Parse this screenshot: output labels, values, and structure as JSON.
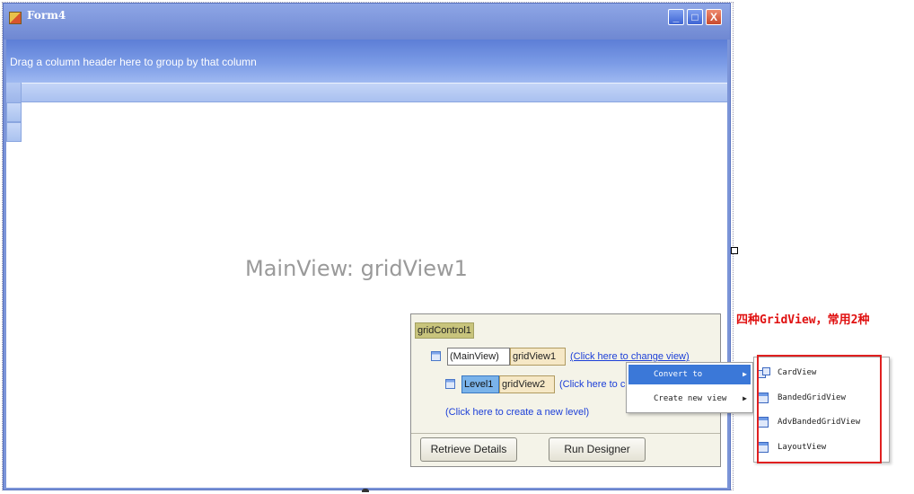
{
  "window": {
    "title": "Form4",
    "group_panel_text": "Drag a column header here to group by that column",
    "main_view_label": "MainView: gridView1"
  },
  "designer": {
    "control_name": "gridControl1",
    "main_view_tag": "(MainView)",
    "main_view_name": "gridView1",
    "change_view_link": "(Click here to change view)",
    "level_tag": "Level1",
    "level_view_name": "gridView2",
    "level_change_link": "(Click here to change view)",
    "new_level_link": "(Click here to create a new level)",
    "retrieve_button": "Retrieve Details",
    "designer_button": "Run Designer"
  },
  "context_menu": {
    "items": [
      {
        "label": "Convert to",
        "has_submenu": true,
        "highlighted": true
      },
      {
        "label": "Create new view",
        "has_submenu": true,
        "highlighted": false
      }
    ]
  },
  "submenu": {
    "items": [
      {
        "label": "CardView",
        "icon": "card-view-icon"
      },
      {
        "label": "BandedGridView",
        "icon": "grid-view-icon"
      },
      {
        "label": "AdvBandedGridView",
        "icon": "grid-view-icon"
      },
      {
        "label": "LayoutView",
        "icon": "grid-view-icon"
      }
    ]
  },
  "annotation": {
    "text": "四种GridView，常用2种",
    "color": "#e01010"
  },
  "colors": {
    "title_bar": "#7c95d8",
    "menu_highlight": "#3b78d8",
    "annotation_red": "#e02020"
  }
}
